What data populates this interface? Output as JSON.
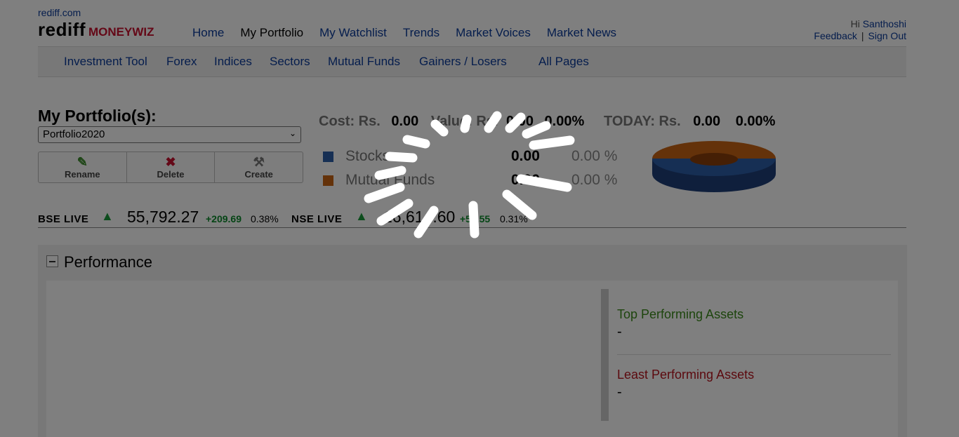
{
  "header": {
    "site_link": "rediff.com",
    "logo_main": "rediff",
    "logo_sub": "MONEYWIZ",
    "nav": [
      "Home",
      "My Portfolio",
      "My Watchlist",
      "Trends",
      "Market Voices",
      "Market News"
    ],
    "active_nav": "My Portfolio",
    "greeting": "Hi",
    "user_name": "Santhoshi",
    "feedback": "Feedback",
    "separator": "|",
    "signout": "Sign Out"
  },
  "sub_nav": [
    "Investment Tool",
    "Forex",
    "Indices",
    "Sectors",
    "Mutual Funds",
    "Gainers / Losers",
    "All Pages"
  ],
  "portfolio": {
    "title": "My Portfolio(s):",
    "selected": "Portfolio2020",
    "actions": [
      {
        "label": "Rename",
        "icon": "pencil-icon"
      },
      {
        "label": "Delete",
        "icon": "delete-x-icon"
      },
      {
        "label": "Create",
        "icon": "tools-icon"
      }
    ]
  },
  "summary": {
    "cost_label": "Cost: Rs.",
    "cost_value": "0.00",
    "value_label": "Value: Rs.",
    "value_value": "0.00",
    "value_pct": "0.00%",
    "today_label": "TODAY: Rs.",
    "today_value": "0.00",
    "today_pct": "0.00%"
  },
  "allocation": [
    {
      "name": "Stocks",
      "value": "0.00",
      "pct": "0.00 %",
      "color": "#2d5fa8"
    },
    {
      "name": "Mutual Funds",
      "value": "0.00",
      "pct": "0.00 %",
      "color": "#c86414"
    }
  ],
  "ticker": {
    "bse_label": "BSE LIVE",
    "bse_value": "55,792.27",
    "bse_change": "+209.69",
    "bse_pct": "0.38%",
    "nse_label": "NSE LIVE",
    "nse_value": "16,614.60",
    "nse_change": "+51.55",
    "nse_pct": "0.31%",
    "up_color": "#1a9a3a"
  },
  "performance": {
    "title": "Performance",
    "top_label": "Top Performing Assets",
    "top_value": "-",
    "least_label": "Least Performing Assets",
    "least_value": "-"
  },
  "overlay": {
    "state": "loading",
    "icon": "loading-spinner-icon"
  }
}
